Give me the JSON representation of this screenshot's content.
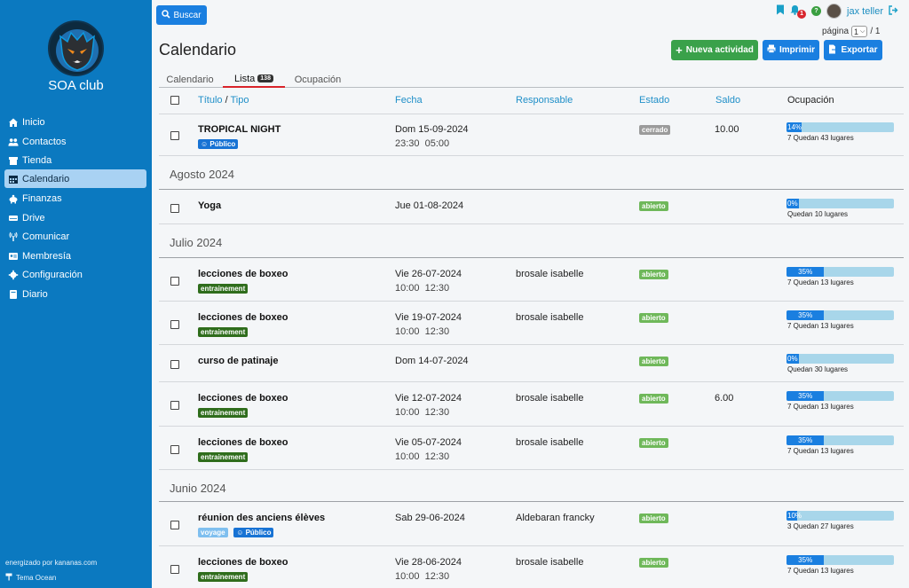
{
  "sidebar": {
    "club_name": "SOA club",
    "items": [
      {
        "label": "Inicio",
        "icon": "home-icon"
      },
      {
        "label": "Contactos",
        "icon": "users-icon"
      },
      {
        "label": "Tienda",
        "icon": "store-icon"
      },
      {
        "label": "Calendario",
        "icon": "calendar-icon",
        "active": true
      },
      {
        "label": "Finanzas",
        "icon": "piggy-bank-icon"
      },
      {
        "label": "Drive",
        "icon": "drive-icon"
      },
      {
        "label": "Comunicar",
        "icon": "broadcast-icon"
      },
      {
        "label": "Membresía",
        "icon": "id-card-icon"
      },
      {
        "label": "Configuración",
        "icon": "gear-icon"
      },
      {
        "label": "Diario",
        "icon": "book-icon"
      }
    ],
    "powered_by": "energizado por kananas.com",
    "theme": "Tema Ocean"
  },
  "topbar": {
    "search_label": "Buscar",
    "notification_count": "1",
    "help_badge": "?",
    "user_name": "jax teller"
  },
  "pager": {
    "label": "página",
    "current": "1",
    "total": "/ 1"
  },
  "page_title": "Calendario",
  "buttons": {
    "new": "Nueva actividad",
    "print": "Imprimir",
    "export": "Exportar"
  },
  "tabs": [
    {
      "label": "Calendario"
    },
    {
      "label": "Lista",
      "count": "138",
      "active": true
    },
    {
      "label": "Ocupación"
    }
  ],
  "columns": {
    "title": "Título",
    "sep": "/",
    "type": "Tipo",
    "date": "Fecha",
    "responsible": "Responsable",
    "state": "Estado",
    "saldo": "Saldo",
    "occupancy": "Ocupación"
  },
  "colors": {
    "sidebar": "#0b79c0",
    "accent": "#1a7fe0",
    "success": "#3aa14a",
    "open": "#6fb85a",
    "closed": "#9b9b9b",
    "tag_ent": "#2f6d1c",
    "bar_bg": "#a8d6ea"
  },
  "events": [
    {
      "title": "TROPICAL NIGHT",
      "tags": [
        {
          "text": "☺ Público",
          "kind": "pub"
        }
      ],
      "date": "Dom 15-09-2024",
      "time": "23:30  05:00",
      "responsible": "",
      "state": "cerrado",
      "state_kind": "closed",
      "saldo": "10.00",
      "pct": "14%",
      "fill": 0.14,
      "occ": "7 Quedan 43 lugares"
    },
    {
      "month": "Agosto 2024"
    },
    {
      "title": "Yoga",
      "tags": [],
      "date": "Jue 01-08-2024",
      "time": "",
      "responsible": "",
      "state": "abierto",
      "state_kind": "open",
      "saldo": "",
      "pct": "0%",
      "fill": 0.0,
      "occ": "Quedan 10 lugares"
    },
    {
      "month": "Julio 2024"
    },
    {
      "title": "lecciones de boxeo",
      "tags": [
        {
          "text": "entrainement",
          "kind": "ent"
        }
      ],
      "date": "Vie 26-07-2024",
      "time": "10:00  12:30",
      "responsible": "brosale isabelle",
      "state": "abierto",
      "state_kind": "open",
      "saldo": "",
      "pct": "35%",
      "fill": 0.35,
      "occ": "7 Quedan 13 lugares"
    },
    {
      "title": "lecciones de boxeo",
      "tags": [
        {
          "text": "entrainement",
          "kind": "ent"
        }
      ],
      "date": "Vie 19-07-2024",
      "time": "10:00  12:30",
      "responsible": "brosale isabelle",
      "state": "abierto",
      "state_kind": "open",
      "saldo": "",
      "pct": "35%",
      "fill": 0.35,
      "occ": "7 Quedan 13 lugares"
    },
    {
      "title": "curso de patinaje",
      "tags": [],
      "date": "Dom 14-07-2024",
      "time": "",
      "responsible": "",
      "state": "abierto",
      "state_kind": "open",
      "saldo": "",
      "pct": "0%",
      "fill": 0.0,
      "occ": "Quedan 30 lugares"
    },
    {
      "title": "lecciones de boxeo",
      "tags": [
        {
          "text": "entrainement",
          "kind": "ent"
        }
      ],
      "date": "Vie 12-07-2024",
      "time": "10:00  12:30",
      "responsible": "brosale isabelle",
      "state": "abierto",
      "state_kind": "open",
      "saldo": "6.00",
      "pct": "35%",
      "fill": 0.35,
      "occ": "7 Quedan 13 lugares"
    },
    {
      "title": "lecciones de boxeo",
      "tags": [
        {
          "text": "entrainement",
          "kind": "ent"
        }
      ],
      "date": "Vie 05-07-2024",
      "time": "10:00  12:30",
      "responsible": "brosale isabelle",
      "state": "abierto",
      "state_kind": "open",
      "saldo": "",
      "pct": "35%",
      "fill": 0.35,
      "occ": "7 Quedan 13 lugares"
    },
    {
      "month": "Junio 2024"
    },
    {
      "title": "réunion des anciens élèves",
      "tags": [
        {
          "text": "voyage",
          "kind": "voy"
        },
        {
          "text": "☺ Público",
          "kind": "pub"
        }
      ],
      "date": "Sab 29-06-2024",
      "time": "",
      "responsible": "Aldebaran francky",
      "state": "abierto",
      "state_kind": "open",
      "saldo": "",
      "pct": "10%",
      "fill": 0.1,
      "occ": "3 Quedan 27 lugares"
    },
    {
      "title": "lecciones de boxeo",
      "tags": [
        {
          "text": "entrainement",
          "kind": "ent"
        }
      ],
      "date": "Vie 28-06-2024",
      "time": "10:00  12:30",
      "responsible": "brosale isabelle",
      "state": "abierto",
      "state_kind": "open",
      "saldo": "",
      "pct": "35%",
      "fill": 0.35,
      "occ": "7 Quedan 13 lugares"
    }
  ]
}
